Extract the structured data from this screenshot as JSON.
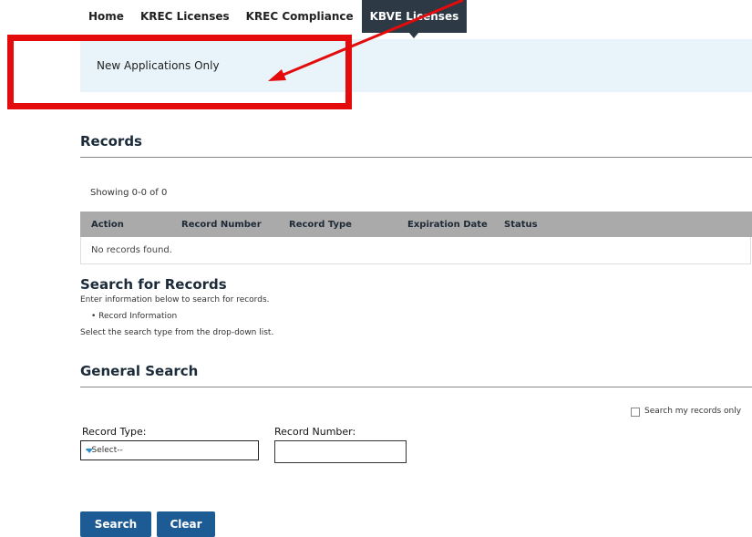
{
  "nav": {
    "items": [
      {
        "label": "Home"
      },
      {
        "label": "KREC Licenses"
      },
      {
        "label": "KREC Compliance"
      },
      {
        "label": "KBVE Licenses"
      }
    ]
  },
  "banner": {
    "text": "New Applications Only"
  },
  "annotation": {
    "color": "#e30b0b"
  },
  "records": {
    "heading": "Records",
    "showing": "Showing 0-0 of 0",
    "columns": [
      "Action",
      "Record Number",
      "Record Type",
      "Expiration Date",
      "Status"
    ],
    "empty_message": "No records found."
  },
  "search": {
    "heading": "Search for Records",
    "intro": "Enter information below to search for records.",
    "bullet": "• Record Information",
    "instruction": "Select the search type from the drop-down list."
  },
  "general_search": {
    "heading": "General Search",
    "my_records_label": "Search my records only",
    "record_type_label": "Record Type:",
    "record_type_value": "--Select--",
    "record_number_label": "Record Number:",
    "record_number_value": "",
    "search_button": "Search",
    "clear_button": "Clear"
  }
}
